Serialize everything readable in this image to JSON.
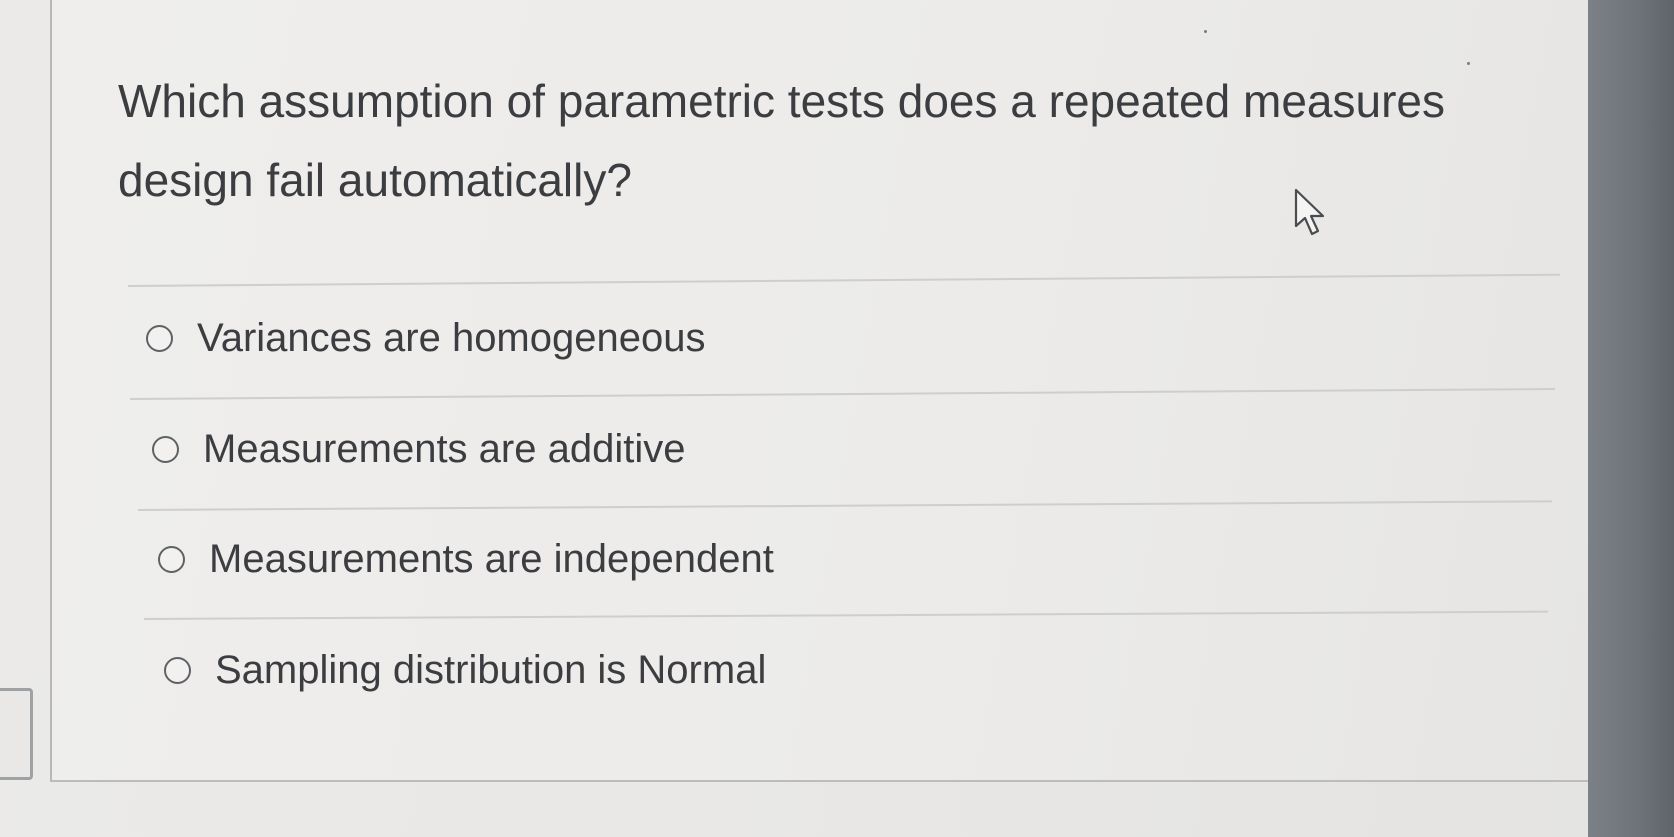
{
  "question": {
    "text": "Which assumption of parametric tests does a repeated measures design fail automatically?"
  },
  "options": [
    {
      "label": "Variances are homogeneous",
      "selected": false
    },
    {
      "label": "Measurements are additive",
      "selected": false
    },
    {
      "label": "Measurements are independent",
      "selected": false
    },
    {
      "label": "Sampling distribution is Normal",
      "selected": false
    }
  ],
  "icons": {
    "radio": "radio-button-icon",
    "cursor": "mouse-pointer-icon"
  },
  "colors": {
    "text": "#3b3d40",
    "panel": "#ecebe9",
    "bezel": "#6d7279"
  }
}
